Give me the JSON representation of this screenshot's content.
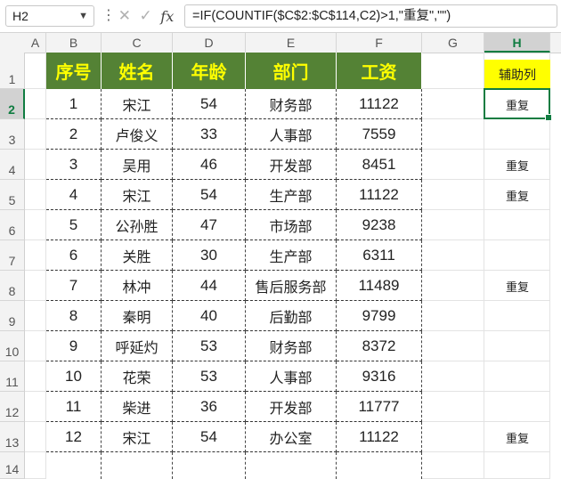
{
  "formula_bar": {
    "name_box": "H2",
    "formula": "=IF(COUNTIF($C$2:$C$114,C2)>1,\"重复\",\"\")",
    "cancel_icon": "close-icon",
    "confirm_icon": "check-icon",
    "function_icon": "fx"
  },
  "columns": [
    "A",
    "B",
    "C",
    "D",
    "E",
    "F",
    "G",
    "H"
  ],
  "selected_column": "H",
  "rows": [
    "1",
    "2",
    "3",
    "4",
    "5",
    "6",
    "7",
    "8",
    "9",
    "10",
    "11",
    "12",
    "13",
    "14"
  ],
  "selected_row": "2",
  "table": {
    "headers": [
      "序号",
      "姓名",
      "年龄",
      "部门",
      "工资"
    ],
    "records": [
      [
        "1",
        "宋江",
        "54",
        "财务部",
        "11122"
      ],
      [
        "2",
        "卢俊义",
        "33",
        "人事部",
        "7559"
      ],
      [
        "3",
        "吴用",
        "46",
        "开发部",
        "8451"
      ],
      [
        "4",
        "宋江",
        "54",
        "生产部",
        "11122"
      ],
      [
        "5",
        "公孙胜",
        "47",
        "市场部",
        "9238"
      ],
      [
        "6",
        "关胜",
        "30",
        "生产部",
        "6311"
      ],
      [
        "7",
        "林冲",
        "44",
        "售后服务部",
        "11489"
      ],
      [
        "8",
        "秦明",
        "40",
        "后勤部",
        "9799"
      ],
      [
        "9",
        "呼延灼",
        "53",
        "财务部",
        "8372"
      ],
      [
        "10",
        "花荣",
        "53",
        "人事部",
        "9316"
      ],
      [
        "11",
        "柴进",
        "36",
        "开发部",
        "11777"
      ],
      [
        "12",
        "宋江",
        "54",
        "办公室",
        "11122"
      ]
    ]
  },
  "helper_column": {
    "header": "辅助列",
    "values": [
      "重复",
      "",
      "重复",
      "重复",
      "",
      "",
      "重复",
      "",
      "",
      "",
      "",
      "重复"
    ]
  },
  "colors": {
    "header_fill": "#548235",
    "header_text": "#ffff00",
    "helper_header_fill": "#ffff00",
    "selection": "#107c41"
  }
}
